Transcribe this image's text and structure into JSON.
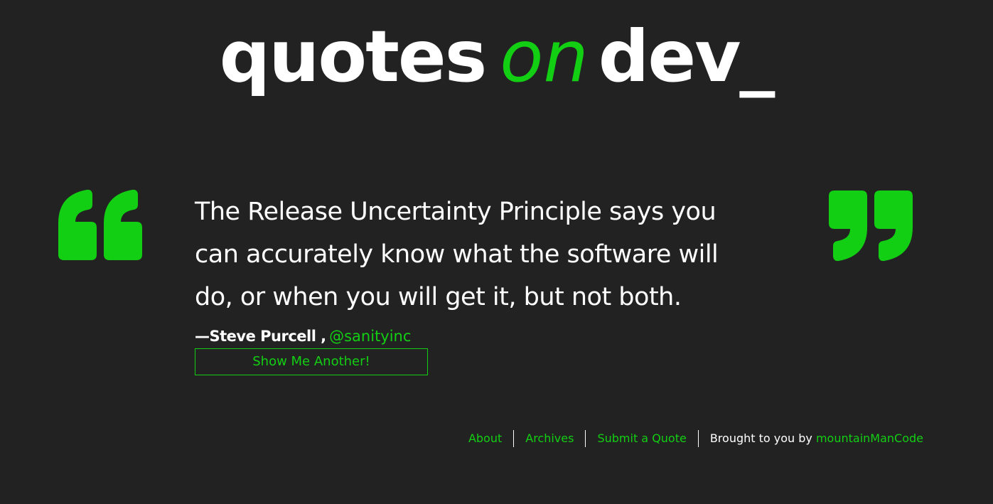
{
  "logo": {
    "word1": "quotes",
    "word2": "on",
    "word3": "dev_"
  },
  "quote": {
    "text": "The Release Uncertainty Principle says you can accurately know what the software will do, or when you will get it, but not both.",
    "author": "—Steve Purcell",
    "separator": ",",
    "source_link": "@sanityinc"
  },
  "actions": {
    "another_label": "Show Me Another!"
  },
  "footer": {
    "about": "About",
    "archives": "Archives",
    "submit": "Submit a Quote",
    "credit_prefix": "Brought to you by",
    "credit_link": "mountainManCode"
  },
  "icons": {
    "open_quote": "open-quote-icon",
    "close_quote": "close-quote-icon"
  },
  "colors": {
    "background": "#222222",
    "accent": "#13cf13",
    "text": "#ffffff"
  }
}
